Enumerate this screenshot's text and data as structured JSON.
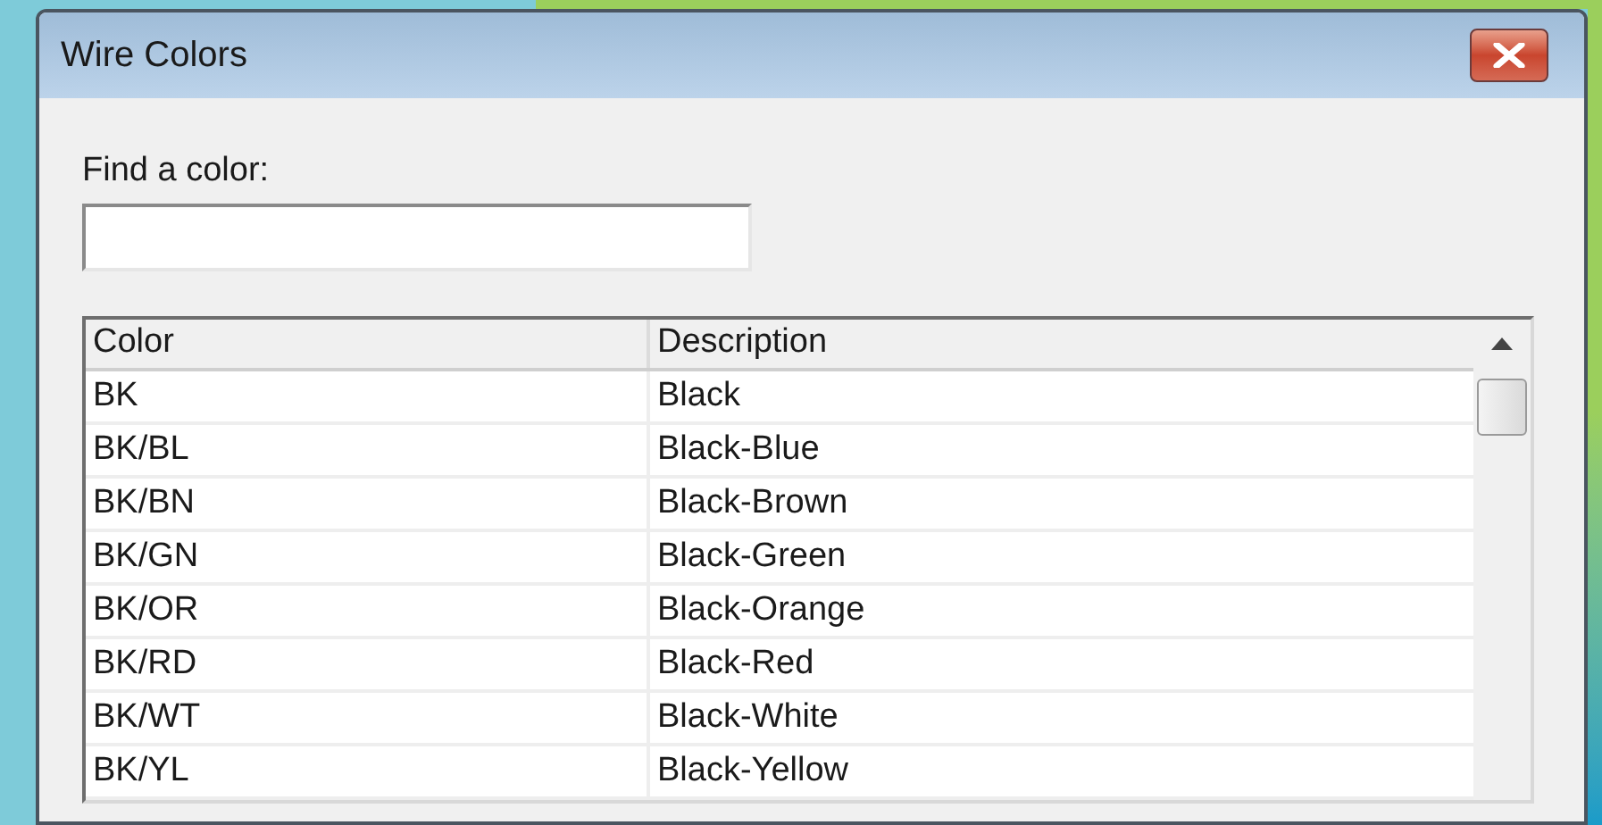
{
  "window": {
    "title": "Wire Colors"
  },
  "search": {
    "label": "Find a color:"
  },
  "table": {
    "columns": [
      "Color",
      "Description"
    ],
    "rows": [
      {
        "code": "BK",
        "description": "Black"
      },
      {
        "code": "BK/BL",
        "description": "Black-Blue"
      },
      {
        "code": "BK/BN",
        "description": "Black-Brown"
      },
      {
        "code": "BK/GN",
        "description": "Black-Green"
      },
      {
        "code": "BK/OR",
        "description": "Black-Orange"
      },
      {
        "code": "BK/RD",
        "description": "Black-Red"
      },
      {
        "code": "BK/WT",
        "description": "Black-White"
      },
      {
        "code": "BK/YL",
        "description": "Black-Yellow"
      }
    ]
  }
}
